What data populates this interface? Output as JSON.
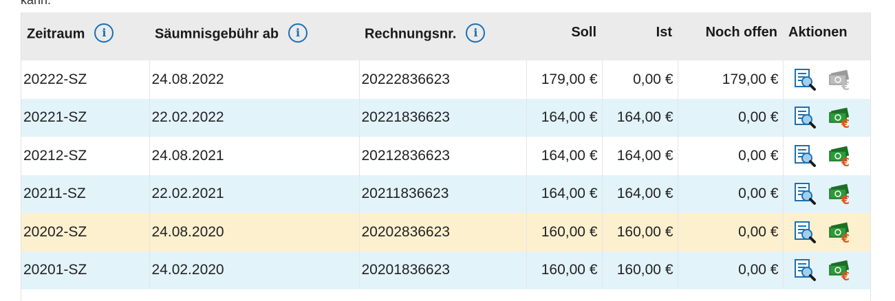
{
  "above_text": "kann.",
  "table": {
    "headers": {
      "zeitraum": "Zeitraum",
      "saeumnis": "Säumnisgebühr ab",
      "rechnung": "Rechnungsnr.",
      "soll": "Soll",
      "ist": "Ist",
      "offen": "Noch offen",
      "aktionen": "Aktionen"
    },
    "info_glyph": "i",
    "rows": [
      {
        "zeitraum": "20222-SZ",
        "saeumnis": "24.08.2022",
        "rechnung": "20222836623",
        "soll": "179,00 €",
        "ist": "0,00 €",
        "offen": "179,00 €",
        "style": "white",
        "pay_enabled": false
      },
      {
        "zeitraum": "20221-SZ",
        "saeumnis": "22.02.2022",
        "rechnung": "20221836623",
        "soll": "164,00 €",
        "ist": "164,00 €",
        "offen": "0,00 €",
        "style": "blue",
        "pay_enabled": true
      },
      {
        "zeitraum": "20212-SZ",
        "saeumnis": "24.08.2021",
        "rechnung": "20212836623",
        "soll": "164,00 €",
        "ist": "164,00 €",
        "offen": "0,00 €",
        "style": "white",
        "pay_enabled": true
      },
      {
        "zeitraum": "20211-SZ",
        "saeumnis": "22.02.2021",
        "rechnung": "20211836623",
        "soll": "164,00 €",
        "ist": "164,00 €",
        "offen": "0,00 €",
        "style": "blue",
        "pay_enabled": true
      },
      {
        "zeitraum": "20202-SZ",
        "saeumnis": "24.08.2020",
        "rechnung": "20202836623",
        "soll": "160,00 €",
        "ist": "160,00 €",
        "offen": "0,00 €",
        "style": "yellow",
        "pay_enabled": true
      },
      {
        "zeitraum": "20201-SZ",
        "saeumnis": "24.02.2020",
        "rechnung": "20201836623",
        "soll": "160,00 €",
        "ist": "160,00 €",
        "offen": "0,00 €",
        "style": "blue",
        "pay_enabled": true
      }
    ]
  },
  "icons": {
    "info": "info-circle-icon",
    "view": "document-magnifier-icon",
    "pay": "money-euro-icon",
    "pay_disabled": "money-euro-disabled-icon"
  },
  "colors": {
    "info_blue": "#1a6fb3",
    "row_blue": "#e2f3fa",
    "row_yellow": "#fdf0cf",
    "header_bg": "#ebebeb",
    "money_green": "#2e9a3a",
    "euro_orange": "#e0541a"
  }
}
